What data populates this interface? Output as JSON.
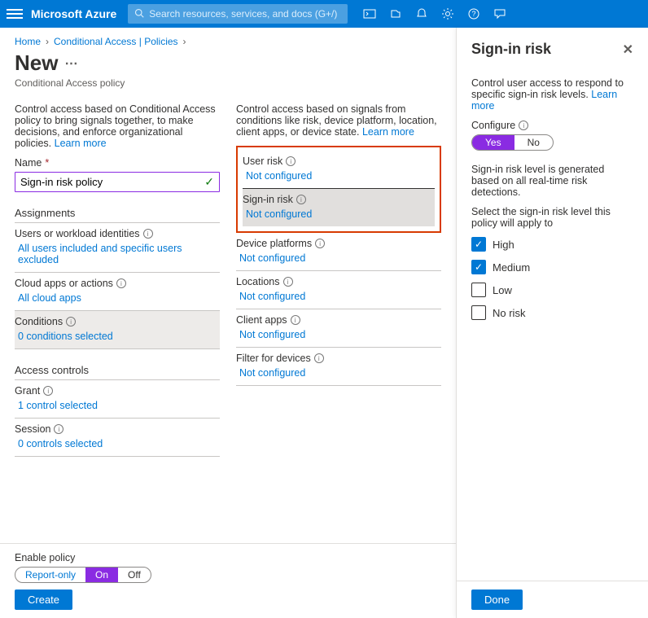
{
  "header": {
    "brand": "Microsoft Azure",
    "search_placeholder": "Search resources, services, and docs (G+/)"
  },
  "breadcrumb": {
    "home": "Home",
    "policies": "Conditional Access | Policies"
  },
  "page": {
    "title": "New",
    "subtitle": "Conditional Access policy"
  },
  "left_col": {
    "desc": "Control access based on Conditional Access policy to bring signals together, to make decisions, and enforce organizational policies.",
    "learn": "Learn more",
    "name_label": "Name",
    "name_value": "Sign-in risk policy",
    "assignments_title": "Assignments",
    "users_label": "Users or workload identities",
    "users_value": "All users included and specific users excluded",
    "apps_label": "Cloud apps or actions",
    "apps_value": "All cloud apps",
    "cond_label": "Conditions",
    "cond_value": "0 conditions selected",
    "access_title": "Access controls",
    "grant_label": "Grant",
    "grant_value": "1 control selected",
    "session_label": "Session",
    "session_value": "0 controls selected",
    "enable_label": "Enable policy",
    "toggle_report": "Report-only",
    "toggle_on": "On",
    "toggle_off": "Off",
    "create_btn": "Create"
  },
  "mid_col": {
    "desc": "Control access based on signals from conditions like risk, device platform, location, client apps, or device state.",
    "learn": "Learn more",
    "user_risk_label": "User risk",
    "user_risk_value": "Not configured",
    "signin_risk_label": "Sign-in risk",
    "signin_risk_value": "Not configured",
    "dev_plat_label": "Device platforms",
    "dev_plat_value": "Not configured",
    "loc_label": "Locations",
    "loc_value": "Not configured",
    "client_label": "Client apps",
    "client_value": "Not configured",
    "filter_label": "Filter for devices",
    "filter_value": "Not configured"
  },
  "panel": {
    "title": "Sign-in risk",
    "desc": "Control user access to respond to specific sign-in risk levels.",
    "learn": "Learn more",
    "configure_label": "Configure",
    "toggle_yes": "Yes",
    "toggle_no": "No",
    "gen_text": "Sign-in risk level is generated based on all real-time risk detections.",
    "select_text": "Select the sign-in risk level this policy will apply to",
    "high": "High",
    "medium": "Medium",
    "low": "Low",
    "norisk": "No risk",
    "done_btn": "Done"
  }
}
